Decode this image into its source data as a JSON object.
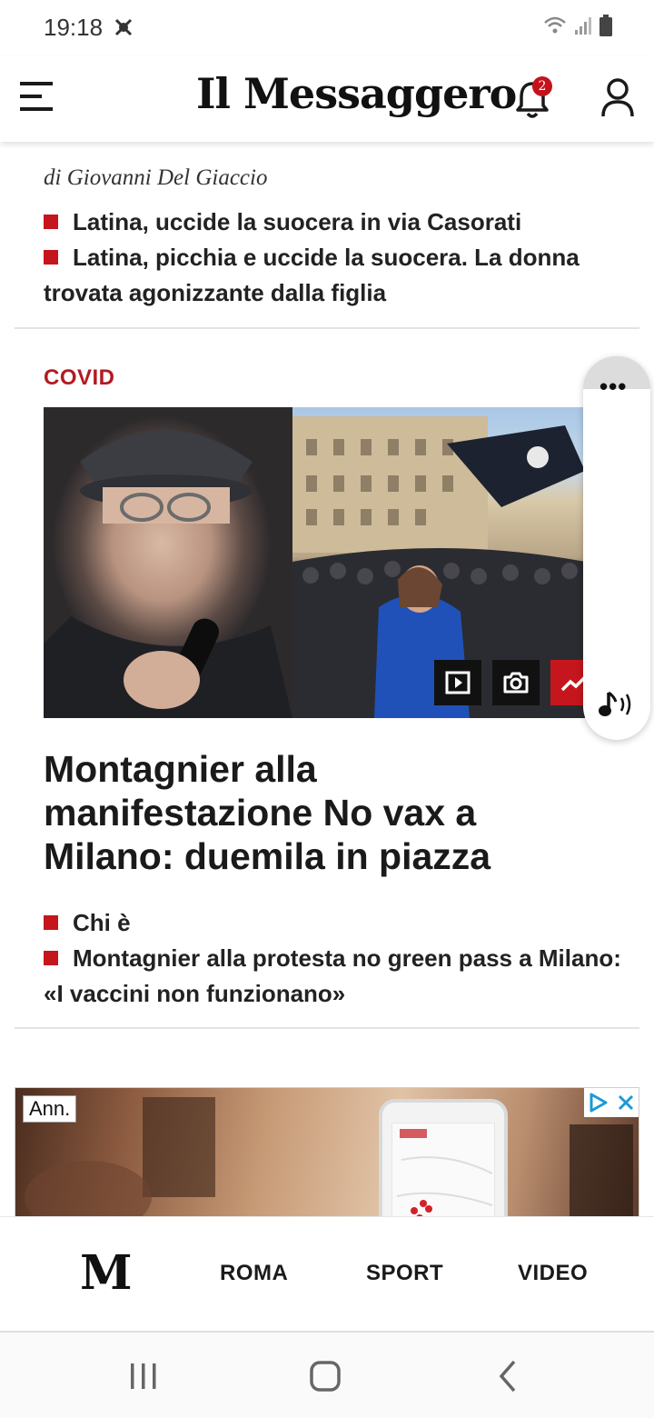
{
  "status_bar": {
    "time": "19:18",
    "icons": [
      "app-notification-icon",
      "wifi-icon",
      "signal-icon",
      "battery-icon"
    ]
  },
  "header": {
    "logo_text": "Il Messaggero",
    "notification_count": "2",
    "icons": [
      "hamburger-menu-icon",
      "bell-icon",
      "user-icon"
    ]
  },
  "previous_article": {
    "byline": "di Giovanni Del Giaccio",
    "related": [
      "Latina, uccide la suocera in via Casorati",
      "Latina, picchia e uccide la suocera. La donna trovata agonizzante dalla figlia"
    ]
  },
  "article": {
    "kicker": "COVID",
    "headline": "Montagnier alla manifestazione No vax a Milano: duemila in piazza",
    "media_icons": [
      "video-icon",
      "camera-icon",
      "trending-icon"
    ],
    "related": [
      "Chi è",
      "Montagnier alla protesta no green pass a Milano: «I vaccini non funzionano»"
    ]
  },
  "floating_player": {
    "icons": [
      "more-options-icon",
      "audio-listen-icon"
    ]
  },
  "ad": {
    "label": "Ann.",
    "icons": [
      "adchoices-icon",
      "close-icon"
    ]
  },
  "bottom_nav": {
    "logo": "M",
    "items": [
      "ROMA",
      "SPORT",
      "VIDEO"
    ]
  },
  "system_nav": {
    "icons": [
      "recent-apps-icon",
      "home-icon",
      "back-icon"
    ]
  },
  "colors": {
    "accent_red": "#c4161c",
    "text": "#1a1a1a",
    "kicker": "#b11b21"
  }
}
